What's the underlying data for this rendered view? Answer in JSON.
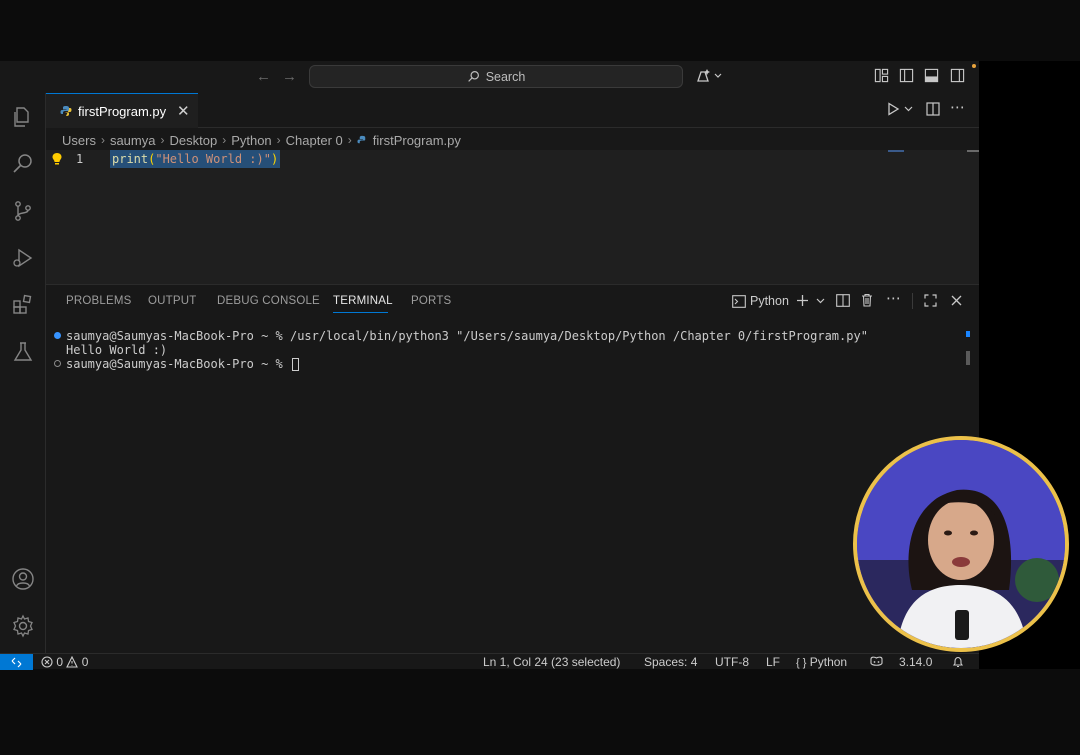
{
  "titlebar": {
    "search_placeholder": "Search"
  },
  "editor": {
    "tab_label": "firstProgram.py",
    "breadcrumb": [
      "Users",
      "saumya",
      "Desktop",
      "Python",
      "Chapter 0",
      "firstProgram.py"
    ],
    "line_number": "1",
    "code": {
      "fn": "print",
      "open": "(",
      "str": "\"Hello World :)\"",
      "close": ")"
    }
  },
  "panel": {
    "tabs": [
      "PROBLEMS",
      "OUTPUT",
      "DEBUG CONSOLE",
      "TERMINAL",
      "PORTS"
    ],
    "active_tab": "TERMINAL",
    "terminal_name": "Python",
    "lines": [
      "saumya@Saumyas-MacBook-Pro ~ % /usr/local/bin/python3 \"/Users/saumya/Desktop/Python /Chapter 0/firstProgram.py\"",
      "Hello World :)",
      "saumya@Saumyas-MacBook-Pro ~ % "
    ]
  },
  "statusbar": {
    "errors": "0",
    "warnings": "0",
    "position": "Ln 1, Col 24 (23 selected)",
    "spaces": "Spaces: 4",
    "encoding": "UTF-8",
    "eol": "LF",
    "language": "Python",
    "version": "3.14.0"
  },
  "colors": {
    "accent": "#0078d4",
    "selection": "#264f78",
    "webcam_border": "#ecc14a"
  }
}
